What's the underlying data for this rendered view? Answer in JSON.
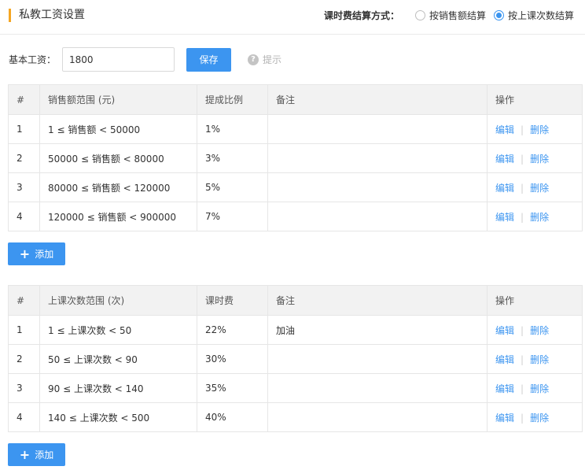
{
  "header": {
    "title": "私教工资设置",
    "settle_label": "课时费结算方式：",
    "options": [
      {
        "label": "按销售额结算",
        "checked": false
      },
      {
        "label": "按上课次数结算",
        "checked": true
      }
    ]
  },
  "salary": {
    "label": "基本工资：",
    "value": "1800",
    "save_label": "保存",
    "hint_label": "提示"
  },
  "table1": {
    "headers": [
      "#",
      "销售额范围 (元)",
      "提成比例",
      "备注",
      "操作"
    ],
    "rows": [
      {
        "idx": "1",
        "range": "1 ≤ 销售额 < 50000",
        "rate": "1%",
        "note": ""
      },
      {
        "idx": "2",
        "range": "50000 ≤ 销售额 < 80000",
        "rate": "3%",
        "note": ""
      },
      {
        "idx": "3",
        "range": "80000 ≤ 销售额 < 120000",
        "rate": "5%",
        "note": ""
      },
      {
        "idx": "4",
        "range": "120000 ≤ 销售额 < 900000",
        "rate": "7%",
        "note": ""
      }
    ],
    "add_label": "添加"
  },
  "table2": {
    "headers": [
      "#",
      "上课次数范围 (次)",
      "课时费",
      "备注",
      "操作"
    ],
    "rows": [
      {
        "idx": "1",
        "range": "1 ≤ 上课次数 < 50",
        "rate": "22%",
        "note": "加油"
      },
      {
        "idx": "2",
        "range": "50 ≤ 上课次数 < 90",
        "rate": "30%",
        "note": ""
      },
      {
        "idx": "3",
        "range": "90 ≤ 上课次数 < 140",
        "rate": "35%",
        "note": ""
      },
      {
        "idx": "4",
        "range": "140 ≤ 上课次数 < 500",
        "rate": "40%",
        "note": ""
      }
    ],
    "add_label": "添加"
  },
  "actions": {
    "edit": "编辑",
    "delete": "删除"
  },
  "colors": {
    "accent": "#3c95f0",
    "title_bar": "#f5a623"
  }
}
